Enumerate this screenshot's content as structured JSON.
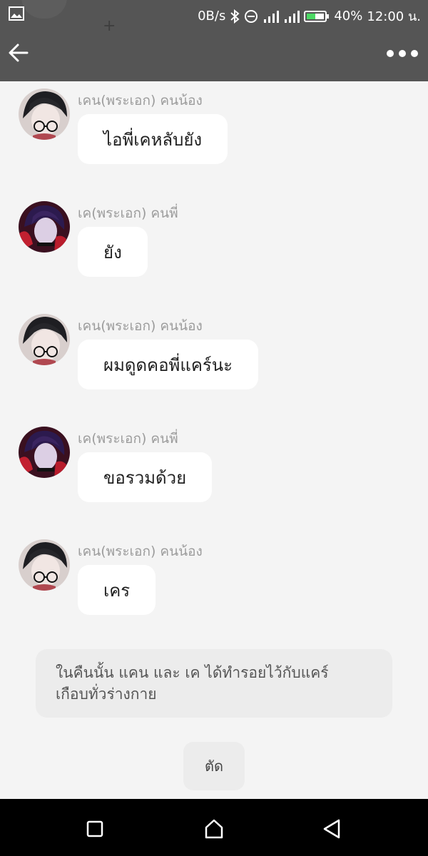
{
  "status_bar": {
    "network_speed": "0B/s",
    "battery_percent": "40%",
    "time": "12:00 น.",
    "icons": [
      "gallery-icon",
      "bluetooth-icon",
      "do-not-disturb-icon",
      "signal-icon",
      "signal-icon",
      "battery-icon"
    ]
  },
  "toolbar": {
    "back_icon": "arrow-left-icon",
    "more_icon": "more-dots-icon"
  },
  "messages": [
    {
      "sender": "เคน(พระเอก) คนน้อง",
      "text": "ไอพี่เคหลับยัง",
      "avatar": "glasses-boy-avatar"
    },
    {
      "sender": "เค(พระเอก) คนพี่",
      "text": "ยัง",
      "avatar": "purple-hair-boy-avatar"
    },
    {
      "sender": "เคน(พระเอก) คนน้อง",
      "text": "ผมดูดคอพี่แคร์นะ",
      "avatar": "glasses-boy-avatar"
    },
    {
      "sender": "เค(พระเอก) คนพี่",
      "text": "ขอรวมด้วย",
      "avatar": "purple-hair-boy-avatar"
    },
    {
      "sender": "เคน(พระเอก) คนน้อง",
      "text": "เคร",
      "avatar": "glasses-boy-avatar"
    }
  ],
  "narration": {
    "line1": "ในคืนนั้น แคน และ เค ได้ทำรอยไว้กับแคร์",
    "line2": "เกือบทั่วร่างกาย"
  },
  "cut_button": {
    "label": "ตัด"
  },
  "colors": {
    "toolbar_bg": "#555555",
    "chat_bg": "#f4f4f4",
    "bubble_bg": "#ffffff",
    "narration_bg": "#ececec",
    "nav_bg": "#000000"
  }
}
